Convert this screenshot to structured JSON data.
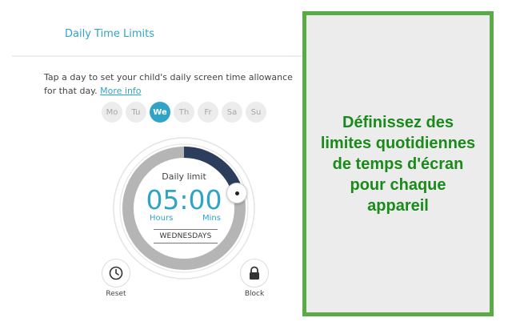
{
  "header": {
    "title": "Daily Time Limits"
  },
  "description": {
    "text": "Tap a day to set your child's daily screen time allowance for that day.",
    "more_info": "More info"
  },
  "days": [
    {
      "label": "Mo",
      "active": false
    },
    {
      "label": "Tu",
      "active": false
    },
    {
      "label": "We",
      "active": true
    },
    {
      "label": "Th",
      "active": false
    },
    {
      "label": "Fr",
      "active": false
    },
    {
      "label": "Sa",
      "active": false
    },
    {
      "label": "Su",
      "active": false
    }
  ],
  "dial": {
    "label": "Daily limit",
    "time": "05:00",
    "hours_label": "Hours",
    "mins_label": "Mins",
    "day": "WEDNESDAYS",
    "used_fraction": 0.2083
  },
  "actions": {
    "reset": "Reset",
    "block": "Block"
  },
  "callout": {
    "text": "Définissez des limites quotidiennes de temps d'écran pour chaque appareil"
  },
  "colors": {
    "accent": "#2fa4c7",
    "dial_filled": "#2c3e5c",
    "dial_track": "#b5b5b5",
    "callout_border": "#5aaa45",
    "callout_text": "#1a8a1a"
  }
}
